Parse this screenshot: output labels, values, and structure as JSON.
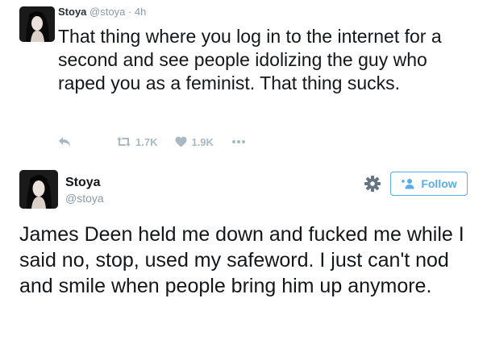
{
  "tweet1": {
    "name": "Stoya",
    "handle": "@stoya",
    "separator": "·",
    "time": "4h",
    "text": "That thing where you log in to the internet for a second and see people idolizing the guy who raped you as a feminist. That thing sucks.",
    "retweets": "1.7K",
    "likes": "1.9K",
    "icons": [
      "reply-icon",
      "retweet-icon",
      "heart-icon",
      "more-icon"
    ]
  },
  "tweet2": {
    "name": "Stoya",
    "handle": "@stoya",
    "follow_label": "Follow",
    "text": "James Deen held me down and fucked me while I said no, stop, used my safeword. I just can't nod and smile when people bring him up anymore.",
    "icons": [
      "gear-icon",
      "follow-person-icon"
    ]
  },
  "colors": {
    "accent": "#55acee",
    "muted": "#8899a6",
    "icon_gray": "#aab8c2",
    "text": "#14171a"
  }
}
